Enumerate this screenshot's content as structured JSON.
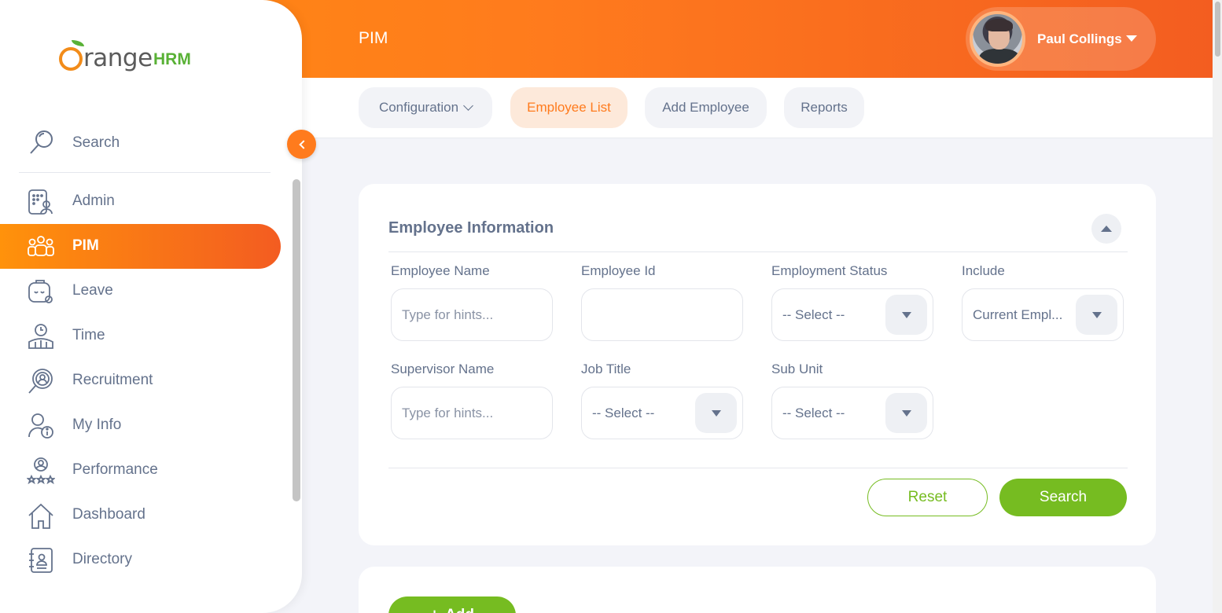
{
  "header": {
    "title": "PIM",
    "user_name": "Paul Collings"
  },
  "tabs": [
    {
      "label": "Configuration",
      "active": false,
      "has_dropdown": true
    },
    {
      "label": "Employee List",
      "active": true,
      "has_dropdown": false
    },
    {
      "label": "Add Employee",
      "active": false,
      "has_dropdown": false
    },
    {
      "label": "Reports",
      "active": false,
      "has_dropdown": false
    }
  ],
  "sidebar": {
    "logo_text": "range",
    "logo_suffix": "HRM",
    "search_label": "Search",
    "items": [
      {
        "label": "Admin",
        "icon": "admin-icon",
        "active": false
      },
      {
        "label": "PIM",
        "icon": "pim-icon",
        "active": true
      },
      {
        "label": "Leave",
        "icon": "leave-icon",
        "active": false
      },
      {
        "label": "Time",
        "icon": "time-icon",
        "active": false
      },
      {
        "label": "Recruitment",
        "icon": "recruitment-icon",
        "active": false
      },
      {
        "label": "My Info",
        "icon": "my-info-icon",
        "active": false
      },
      {
        "label": "Performance",
        "icon": "performance-icon",
        "active": false
      },
      {
        "label": "Dashboard",
        "icon": "dashboard-icon",
        "active": false
      },
      {
        "label": "Directory",
        "icon": "directory-icon",
        "active": false
      }
    ]
  },
  "filter": {
    "title": "Employee Information",
    "employee_name": {
      "label": "Employee Name",
      "placeholder": "Type for hints...",
      "value": ""
    },
    "employee_id": {
      "label": "Employee Id",
      "value": ""
    },
    "employment_status": {
      "label": "Employment Status",
      "value": "-- Select --"
    },
    "include": {
      "label": "Include",
      "value": "Current Empl..."
    },
    "supervisor_name": {
      "label": "Supervisor Name",
      "placeholder": "Type for hints...",
      "value": ""
    },
    "job_title": {
      "label": "Job Title",
      "value": "-- Select --"
    },
    "sub_unit": {
      "label": "Sub Unit",
      "value": "-- Select --"
    },
    "reset_label": "Reset",
    "search_label": "Search"
  },
  "list": {
    "add_label": "Add"
  },
  "colors": {
    "accent": "#ff7b1d",
    "brand_green": "#76bc21",
    "text": "#64728c"
  }
}
